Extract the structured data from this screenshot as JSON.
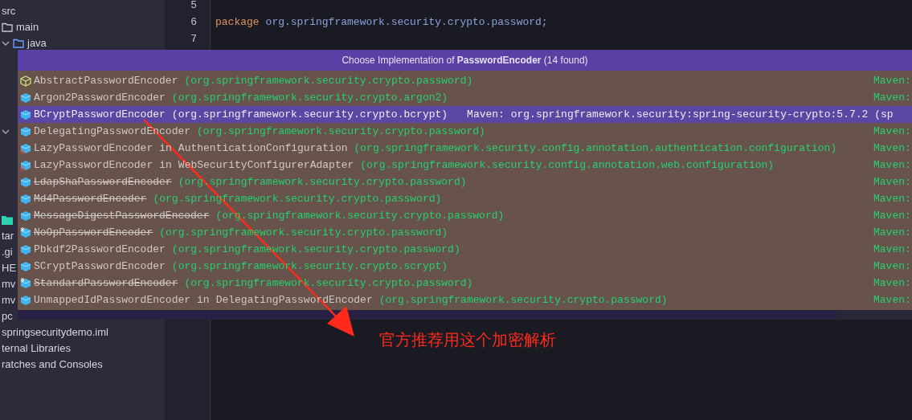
{
  "sidebar": {
    "tree": [
      {
        "label": "src",
        "expanded": true,
        "children": [
          {
            "label": "main",
            "expanded": true,
            "children": [
              {
                "label": "java",
                "expanded": true
              }
            ]
          }
        ]
      }
    ],
    "items_below": [
      {
        "kind": "folder"
      },
      {
        "kind": "text",
        "label": "tar"
      },
      {
        "kind": "text",
        "label": ".gi"
      },
      {
        "kind": "text",
        "label": "HE"
      },
      {
        "kind": "text",
        "label": "mv"
      },
      {
        "kind": "text",
        "label": "mv"
      },
      {
        "kind": "text",
        "label": "pc"
      },
      {
        "kind": "text",
        "label": "springsecuritydemo.iml"
      },
      {
        "kind": "text",
        "label": "ternal Libraries"
      },
      {
        "kind": "text",
        "label": "ratches and Consoles"
      }
    ]
  },
  "editor": {
    "lines": [
      {
        "number": "5"
      },
      {
        "number": "6",
        "tokens": [
          {
            "kind": "keyword",
            "text": "package"
          },
          {
            "kind": "plain",
            "text": "org.springframework.security.crypto.password;"
          }
        ]
      },
      {
        "number": "7"
      }
    ]
  },
  "popup": {
    "title": "Choose Implementation of **PasswordEncoder** (14 found)",
    "rows": [
      {
        "kind": "abstract",
        "name": "AbstractPasswordEncoder",
        "package": "(org.springframework.security.crypto.password)",
        "deprecated": false,
        "selected": false,
        "maven": "Maven:"
      },
      {
        "kind": "class",
        "name": "Argon2PasswordEncoder",
        "package": "(org.springframework.security.crypto.argon2)",
        "deprecated": false,
        "selected": false,
        "maven": "Maven:"
      },
      {
        "kind": "class",
        "name": "BCryptPasswordEncoder",
        "package": "(org.springframework.security.crypto.bcrypt)",
        "deprecated": false,
        "selected": true,
        "maven": "Maven: org.springframework.security:spring-security-crypto:5.7.2 (sp"
      },
      {
        "kind": "class",
        "name": "DelegatingPasswordEncoder",
        "package": "(org.springframework.security.crypto.password)",
        "deprecated": false,
        "selected": false,
        "maven": "Maven:"
      },
      {
        "kind": "private",
        "name": "LazyPasswordEncoder",
        "in": "in",
        "outer": "AuthenticationConfiguration",
        "package": "(org.springframework.security.config.annotation.authentication.configuration)",
        "deprecated": false,
        "selected": false,
        "maven": "Maven:"
      },
      {
        "kind": "private",
        "name": "LazyPasswordEncoder",
        "in": "in",
        "outer": "WebSecurityConfigurerAdapter",
        "package": "(org.springframework.security.config.annotation.web.configuration)",
        "deprecated": false,
        "selected": false,
        "maven": "Maven:"
      },
      {
        "kind": "class",
        "name": "LdapShaPasswordEncoder",
        "package": "(org.springframework.security.crypto.password)",
        "deprecated": true,
        "selected": false,
        "maven": "Maven:"
      },
      {
        "kind": "class",
        "name": "Md4PasswordEncoder",
        "package": "(org.springframework.security.crypto.password)",
        "deprecated": true,
        "selected": false,
        "maven": "Maven:"
      },
      {
        "kind": "class",
        "name": "MessageDigestPasswordEncoder",
        "package": "(org.springframework.security.crypto.password)",
        "deprecated": true,
        "selected": false,
        "maven": "Maven:"
      },
      {
        "kind": "static",
        "name": "NoOpPasswordEncoder",
        "package": "(org.springframework.security.crypto.password)",
        "deprecated": true,
        "selected": false,
        "maven": "Maven:"
      },
      {
        "kind": "class",
        "name": "Pbkdf2PasswordEncoder",
        "package": "(org.springframework.security.crypto.password)",
        "deprecated": false,
        "selected": false,
        "maven": "Maven:"
      },
      {
        "kind": "class",
        "name": "SCryptPasswordEncoder",
        "package": "(org.springframework.security.crypto.scrypt)",
        "deprecated": false,
        "selected": false,
        "maven": "Maven:"
      },
      {
        "kind": "static",
        "name": "StandardPasswordEncoder",
        "package": "(org.springframework.security.crypto.password)",
        "deprecated": true,
        "selected": false,
        "maven": "Maven:"
      },
      {
        "kind": "class",
        "name": "UnmappedIdPasswordEncoder",
        "in": "in",
        "outer": "DelegatingPasswordEncoder",
        "package": "(org.springframework.security.crypto.password)",
        "deprecated": false,
        "selected": false,
        "maven": "Maven:"
      }
    ]
  },
  "annotation": {
    "text": "官方推荐用这个加密解析"
  }
}
